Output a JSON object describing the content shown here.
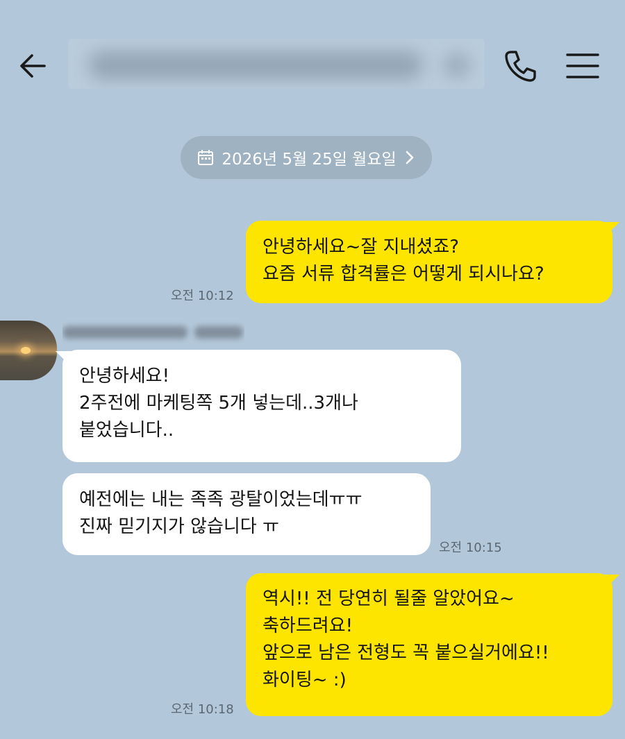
{
  "header": {
    "back_icon": "arrow-left-icon",
    "title": "",
    "call_icon": "phone-icon",
    "menu_icon": "hamburger-menu-icon"
  },
  "date_divider": {
    "icon": "calendar-icon",
    "label": "2026년 5월 25일 월요일",
    "chevron_icon": "chevron-right-icon"
  },
  "colors": {
    "background": "#b2c7d9",
    "my_bubble": "#fee500",
    "their_bubble": "#ffffff",
    "timestamp": "#5b6772"
  },
  "messages": [
    {
      "from": "me",
      "lines": [
        "안녕하세요~잘 지내셨죠?",
        "요즘 서류 합격률은 어떻게 되시나요?"
      ],
      "time": "오전 10:12"
    },
    {
      "from": "other",
      "sender_name": "",
      "avatar": "sunset-avatar",
      "lines": [
        "안녕하세요!",
        "2주전에 마케팅쪽 5개 넣는데..3개나",
        "붙었습니다.."
      ]
    },
    {
      "from": "other",
      "lines": [
        "예전에는 내는 족족 광탈이었는데ㅠㅠ",
        "진짜 믿기지가 않습니다 ㅠ"
      ],
      "time": "오전 10:15"
    },
    {
      "from": "me",
      "lines": [
        "역시!! 전 당연히 될줄 알았어요~",
        "축하드려요!",
        "앞으로 남은 전형도 꼭 붙으실거에요!!",
        "화이팅~ :)"
      ],
      "time": "오전 10:18"
    }
  ]
}
